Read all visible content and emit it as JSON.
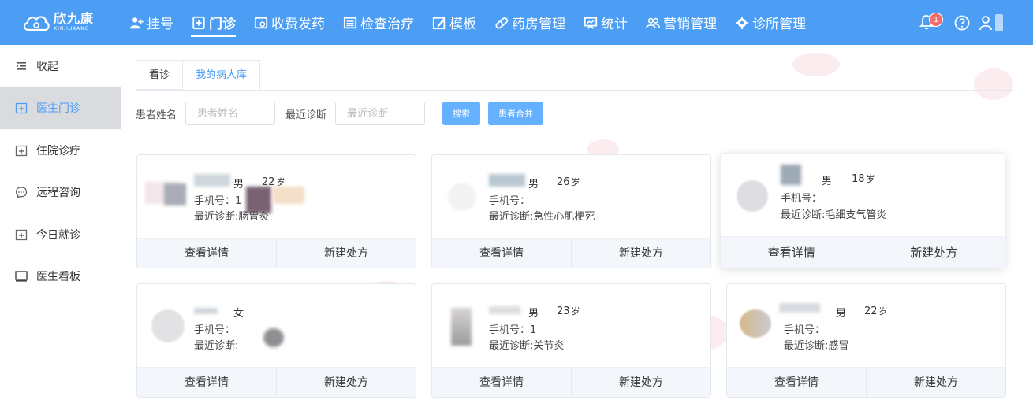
{
  "header": {
    "logo_cn": "欣九康",
    "logo_en": "XINJIUKANG",
    "nav": [
      {
        "label": "挂号",
        "icon": "user-plus-icon"
      },
      {
        "label": "门诊",
        "icon": "plus-square-icon",
        "active": true
      },
      {
        "label": "收费发药",
        "icon": "pay-icon"
      },
      {
        "label": "检查治疗",
        "icon": "list-icon"
      },
      {
        "label": "模板",
        "icon": "edit-icon"
      },
      {
        "label": "药房管理",
        "icon": "pill-icon"
      },
      {
        "label": "统计",
        "icon": "chart-icon"
      },
      {
        "label": "营销管理",
        "icon": "users-icon"
      },
      {
        "label": "诊所管理",
        "icon": "gear-icon"
      }
    ],
    "notification_count": "1"
  },
  "sidebar": {
    "items": [
      {
        "label": "收起",
        "icon": "collapse-icon"
      },
      {
        "label": "医生门诊",
        "icon": "plus-calendar-icon",
        "active": true
      },
      {
        "label": "住院诊疗",
        "icon": "plus-calendar-icon"
      },
      {
        "label": "远程咨询",
        "icon": "chat-icon"
      },
      {
        "label": "今日就诊",
        "icon": "plus-calendar-icon"
      },
      {
        "label": "医生看板",
        "icon": "monitor-icon"
      }
    ]
  },
  "tabs": [
    {
      "label": "看诊"
    },
    {
      "label": "我的病人库",
      "active": true
    }
  ],
  "filters": {
    "name_label": "患者姓名",
    "name_placeholder": "患者姓名",
    "diag_label": "最近诊断",
    "diag_placeholder": "最近诊断",
    "search_button": "搜索",
    "merge_button": "患者合并"
  },
  "cards": [
    {
      "gender": "男",
      "age": "22",
      "age_unit": "岁",
      "phone": "手机号：1",
      "diag": "最近诊断:肠胃炎"
    },
    {
      "gender": "男",
      "age": "26",
      "age_unit": "岁",
      "phone": "手机号：",
      "diag": "最近诊断:急性心肌梗死"
    },
    {
      "gender": "男",
      "age": "18",
      "age_unit": "岁",
      "phone": "手机号：",
      "diag": "最近诊断:毛细支气管炎"
    },
    {
      "gender": "女",
      "age": "",
      "age_unit": "",
      "phone": "手机号：",
      "diag": "最近诊断:"
    },
    {
      "gender": "男",
      "age": "23",
      "age_unit": "岁",
      "phone": "手机号：1",
      "diag": "最近诊断:关节炎"
    },
    {
      "gender": "男",
      "age": "22",
      "age_unit": "岁",
      "phone": "手机号：",
      "diag": "最近诊断:感冒"
    }
  ],
  "card_actions": {
    "detail": "查看详情",
    "prescribe": "新建处方"
  }
}
